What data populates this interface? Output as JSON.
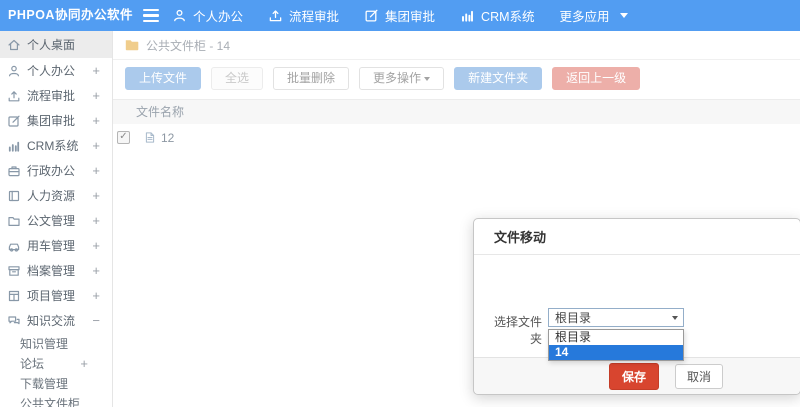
{
  "topbar": {
    "logo": "PHPOA协同办公软件",
    "nav": [
      {
        "label": "个人办公",
        "icon": "user-icon"
      },
      {
        "label": "流程审批",
        "icon": "upload-icon"
      },
      {
        "label": "集团审批",
        "icon": "edit-icon"
      },
      {
        "label": "CRM系统",
        "icon": "chart-icon"
      },
      {
        "label": "更多应用",
        "caret": true
      }
    ]
  },
  "sidebar": {
    "items": [
      {
        "label": "个人桌面",
        "icon": "home-icon",
        "active": true
      },
      {
        "label": "个人办公",
        "icon": "user-icon",
        "expand": "+"
      },
      {
        "label": "流程审批",
        "icon": "upload-icon",
        "expand": "+"
      },
      {
        "label": "集团审批",
        "icon": "edit-icon",
        "expand": "+"
      },
      {
        "label": "CRM系统",
        "icon": "chart-icon",
        "expand": "+"
      },
      {
        "label": "行政办公",
        "icon": "briefcase-icon",
        "expand": "+"
      },
      {
        "label": "人力资源",
        "icon": "book-icon",
        "expand": "+"
      },
      {
        "label": "公文管理",
        "icon": "folder-outline-icon",
        "expand": "+"
      },
      {
        "label": "用车管理",
        "icon": "car-icon",
        "expand": "+"
      },
      {
        "label": "档案管理",
        "icon": "archive-icon",
        "expand": "+"
      },
      {
        "label": "项目管理",
        "icon": "board-icon",
        "expand": "+"
      },
      {
        "label": "知识交流",
        "icon": "chat-icon",
        "expand": "−"
      }
    ],
    "subitems": [
      {
        "label": "知识管理"
      },
      {
        "label": "论坛",
        "expand": "+"
      },
      {
        "label": "下载管理"
      },
      {
        "label": "公共文件柜"
      }
    ]
  },
  "breadcrumb": {
    "icon": "folder-icon",
    "text": "公共文件柜 - 14"
  },
  "toolbar": {
    "upload": "上传文件",
    "select_all": "全选",
    "batch_delete": "批量删除",
    "more_actions": "更多操作",
    "new_folder": "新建文件夹",
    "go_back": "返回上一级"
  },
  "file_table": {
    "name_header": "文件名称",
    "rows": [
      {
        "name": "12",
        "icon": "file-icon",
        "checked": true
      }
    ]
  },
  "modal": {
    "title": "文件移动",
    "field_label": "选择文件夹",
    "select_value": "根目录",
    "options": [
      {
        "label": "根目录"
      },
      {
        "label": "14",
        "selected": true
      }
    ],
    "save_label": "保存",
    "cancel_label": "取消"
  },
  "colors": {
    "topbar_blue": "#529df2",
    "button_blue": "#abcaec",
    "button_red": "#edafa9",
    "save_red": "#d8452f",
    "option_highlight_blue": "#2679db",
    "folder_yellow": "#f0cd8c",
    "sidebar_active_bg": "#ececec"
  }
}
